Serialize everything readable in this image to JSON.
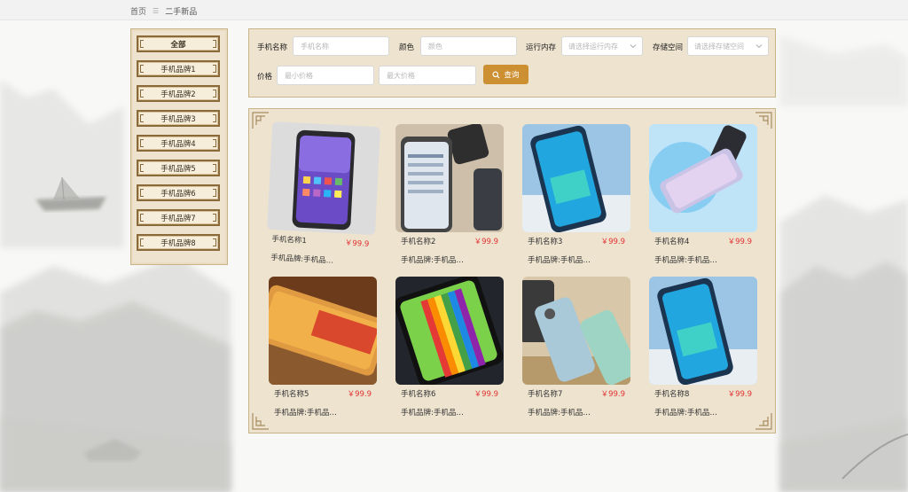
{
  "breadcrumb": {
    "home": "首页",
    "separator": "☰",
    "current": "二手新品"
  },
  "sidebar": {
    "items": [
      {
        "label": "全部",
        "active": true
      },
      {
        "label": "手机品牌1"
      },
      {
        "label": "手机品牌2"
      },
      {
        "label": "手机品牌3"
      },
      {
        "label": "手机品牌4"
      },
      {
        "label": "手机品牌5"
      },
      {
        "label": "手机品牌6"
      },
      {
        "label": "手机品牌7"
      },
      {
        "label": "手机品牌8"
      }
    ]
  },
  "filter": {
    "name_label": "手机名称",
    "name_placeholder": "手机名称",
    "color_label": "颜色",
    "color_placeholder": "颜色",
    "ram_label": "运行内存",
    "ram_placeholder": "请选择运行内存",
    "storage_label": "存储空间",
    "storage_placeholder": "请选择存储空间",
    "price_label": "价格",
    "min_price_placeholder": "最小价格",
    "max_price_placeholder": "最大价格",
    "search_label": "查询"
  },
  "products": [
    {
      "name": "手机名称1",
      "price": "￥99.9",
      "brand": "手机品牌:手机品…"
    },
    {
      "name": "手机名称2",
      "price": "￥99.9",
      "brand": "手机品牌:手机品…"
    },
    {
      "name": "手机名称3",
      "price": "￥99.9",
      "brand": "手机品牌:手机品…"
    },
    {
      "name": "手机名称4",
      "price": "￥99.9",
      "brand": "手机品牌:手机品…"
    },
    {
      "name": "手机名称5",
      "price": "￥99.9",
      "brand": "手机品牌:手机品…"
    },
    {
      "name": "手机名称6",
      "price": "￥99.9",
      "brand": "手机品牌:手机品…"
    },
    {
      "name": "手机名称7",
      "price": "￥99.9",
      "brand": "手机品牌:手机品…"
    },
    {
      "name": "手机名称8",
      "price": "￥99.9",
      "brand": "手机品牌:手机品…"
    }
  ],
  "colors": {
    "accent": "#cc9033",
    "price": "#e23232",
    "panel": "#ede3cf",
    "border": "#8a6a3b"
  }
}
